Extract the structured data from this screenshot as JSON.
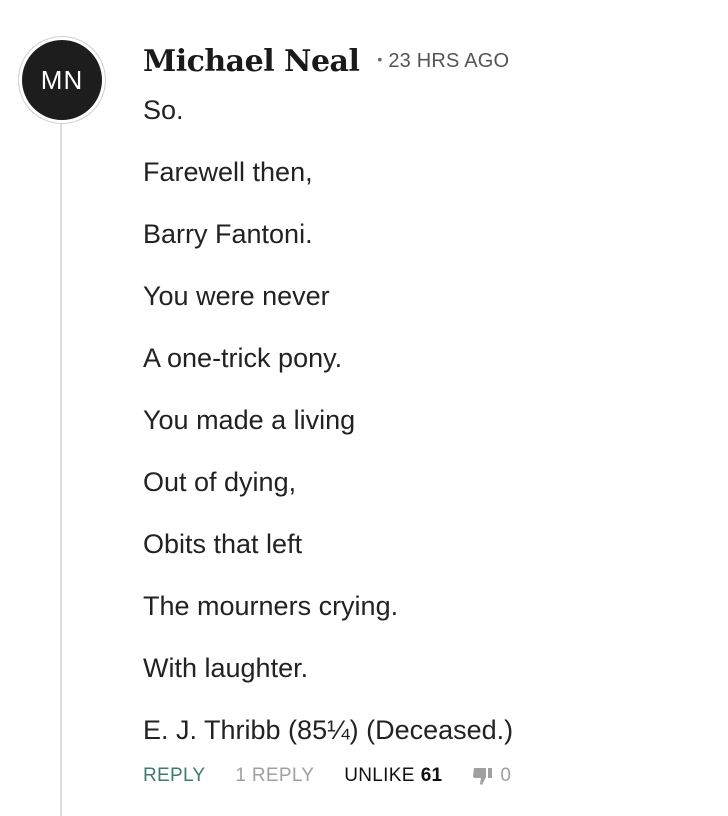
{
  "comment": {
    "avatar_initials": "MN",
    "author": "Michael Neal",
    "separator": "•",
    "timestamp": "23 HRS AGO",
    "lines": [
      "So.",
      "Farewell then,",
      "Barry Fantoni.",
      "You were never",
      "A one-trick pony.",
      "You made a living",
      "Out of dying,",
      "Obits that left",
      "The mourners crying.",
      "With laughter.",
      "E. J. Thribb (85¼) (Deceased.)"
    ],
    "actions": {
      "reply_label": "REPLY",
      "replies_label": "1 REPLY",
      "unlike_label": "UNLIKE",
      "like_count": "61",
      "dislike_icon": "thumb-down-icon",
      "dislike_count": "0"
    }
  },
  "colors": {
    "reply": "#3f7a6e",
    "muted": "#a0a0a0",
    "avatar_bg": "#1d1d1d",
    "thread_line": "#dcdcdc"
  }
}
